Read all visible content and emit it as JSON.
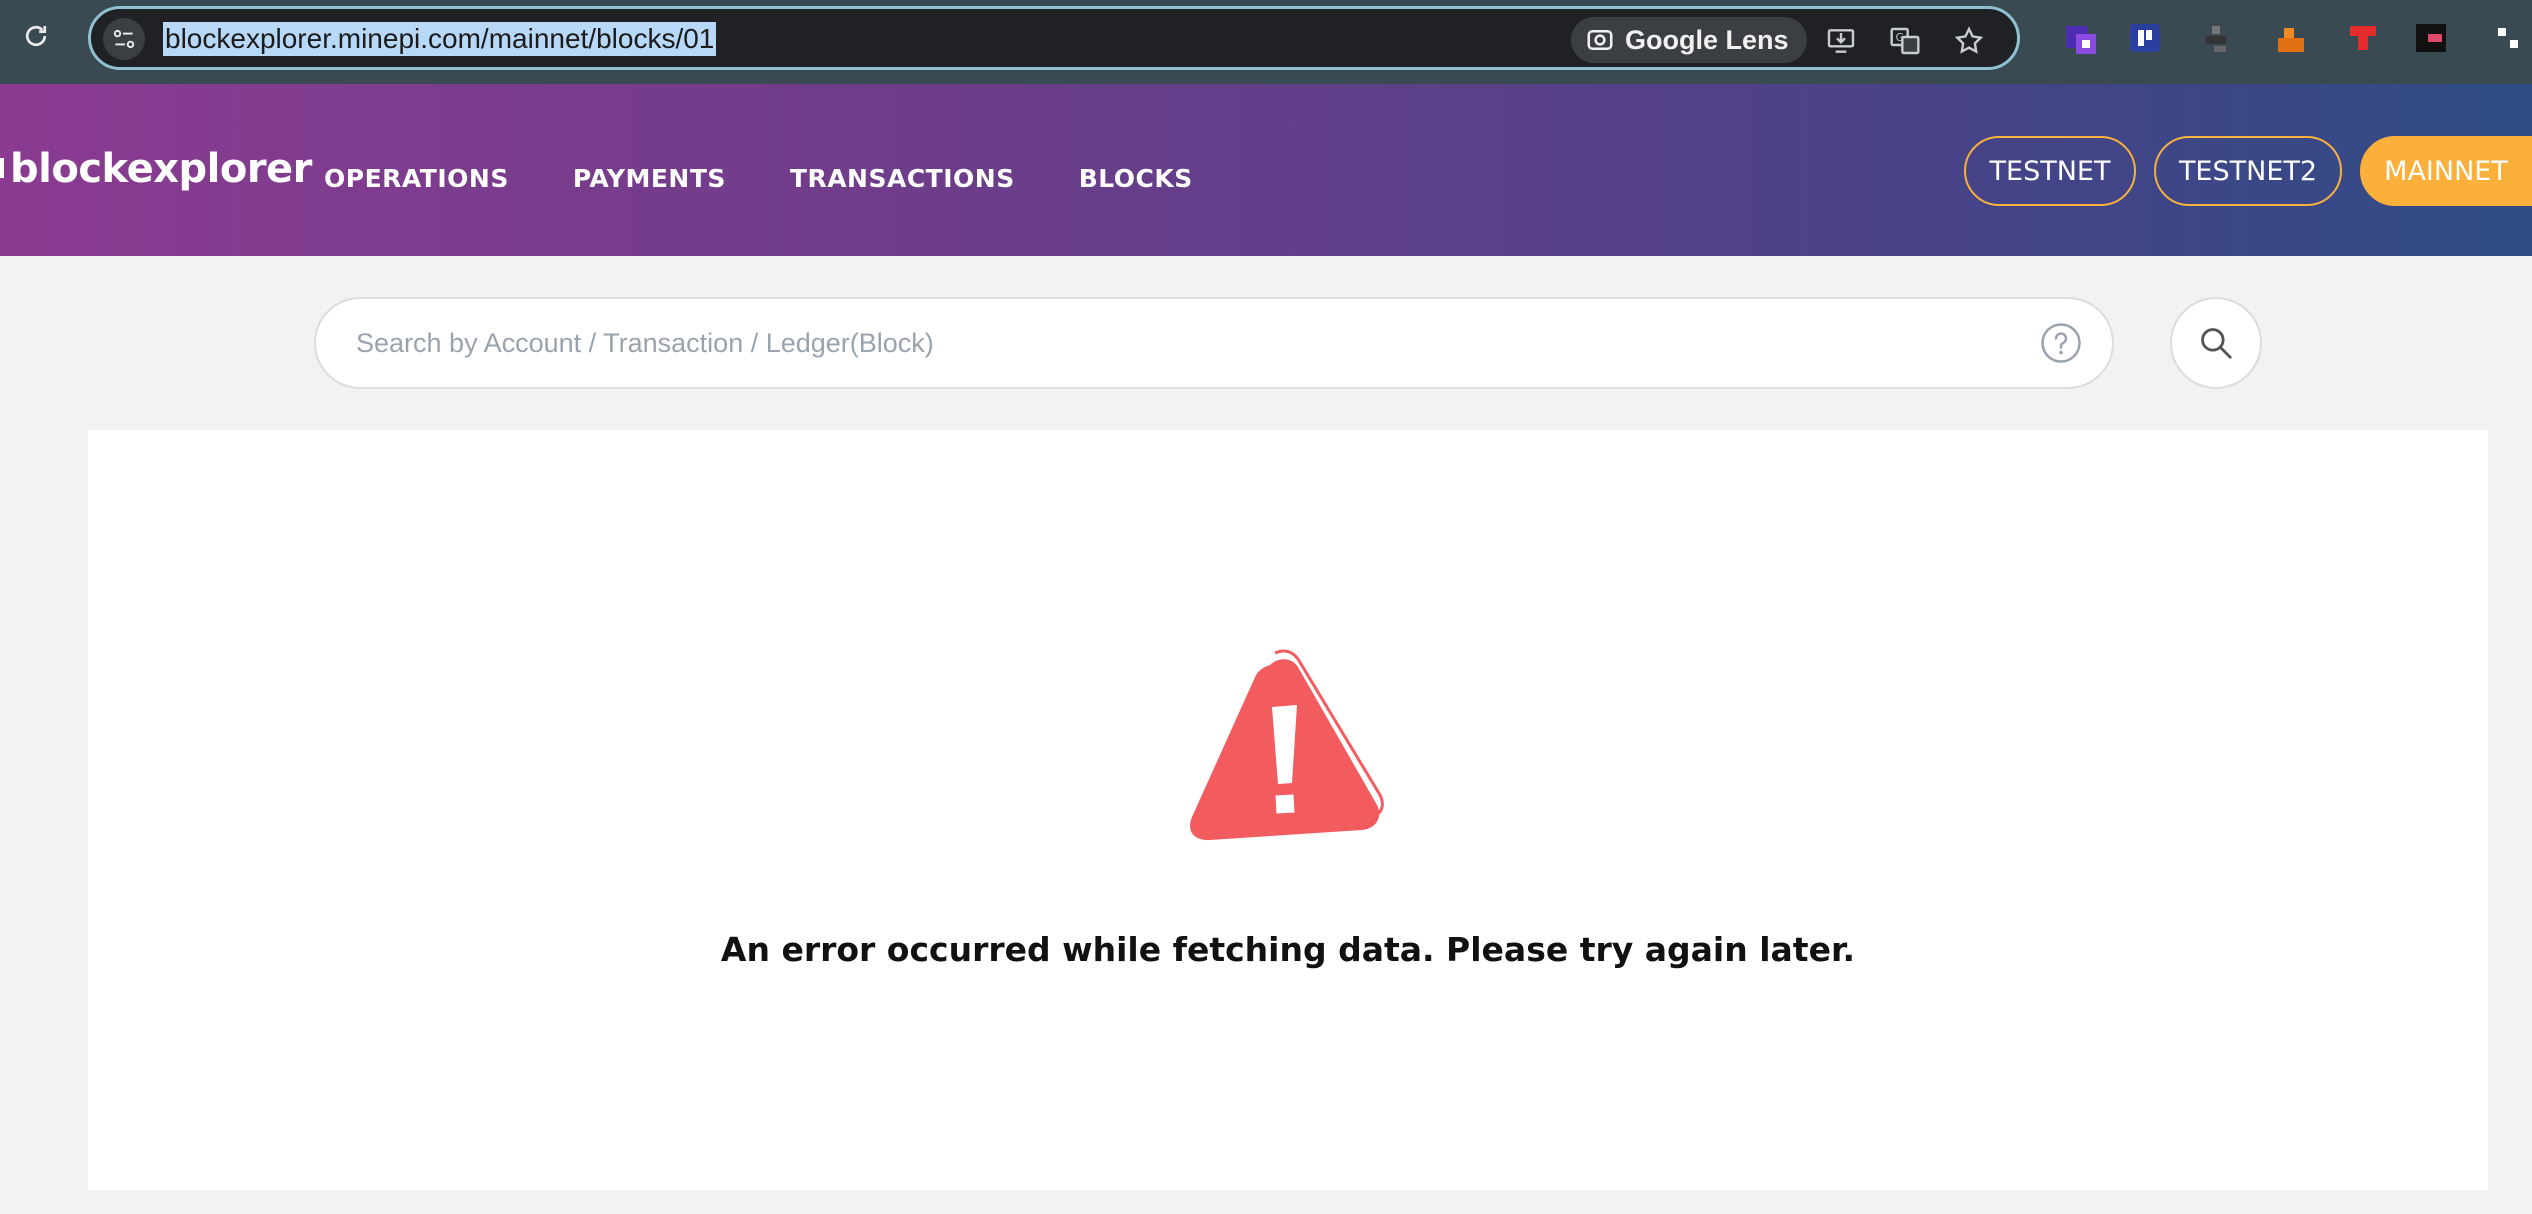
{
  "browser": {
    "url": "blockexplorer.minepi.com/mainnet/blocks/01",
    "lens_label": "Google Lens"
  },
  "site": {
    "brand": "blockexplorer",
    "nav": [
      "OPERATIONS",
      "PAYMENTS",
      "TRANSACTIONS",
      "BLOCKS"
    ],
    "networks": [
      "TESTNET",
      "TESTNET2",
      "MAINNET"
    ],
    "active_network": "MAINNET"
  },
  "search": {
    "placeholder": "Search by Account / Transaction / Ledger(Block)",
    "value": ""
  },
  "error": {
    "message": "An error occurred while fetching data. Please try again later."
  },
  "colors": {
    "accent": "#fbb03b",
    "error": "#f25c5f"
  }
}
